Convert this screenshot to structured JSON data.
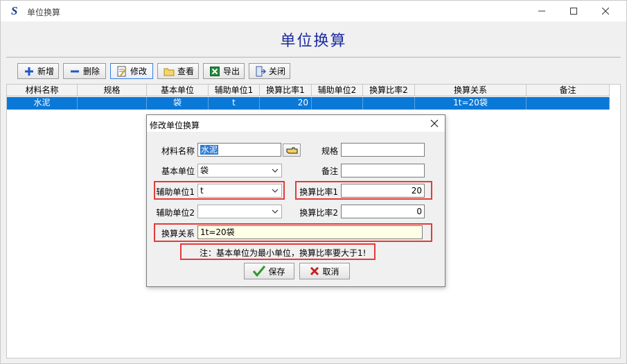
{
  "window": {
    "title": "单位换算"
  },
  "banner": {
    "title": "单位换算"
  },
  "toolbar": {
    "add": "新增",
    "delete": "删除",
    "edit": "修改",
    "view": "查看",
    "export": "导出",
    "close": "关闭"
  },
  "table": {
    "columns": [
      "材料名称",
      "规格",
      "基本单位",
      "辅助单位1",
      "换算比率1",
      "辅助单位2",
      "换算比率2",
      "换算关系",
      "备注"
    ],
    "rows": [
      {
        "name": "水泥",
        "spec": "",
        "base_unit": "袋",
        "aux_unit1": "t",
        "ratio1": "20",
        "aux_unit2": "",
        "ratio2": "",
        "relation": "1t=20袋",
        "remark": ""
      }
    ]
  },
  "dialog": {
    "title": "修改单位换算",
    "labels": {
      "material_name": "材料名称",
      "spec": "规格",
      "base_unit": "基本单位",
      "remark": "备注",
      "aux_unit1": "辅助单位1",
      "ratio1": "换算比率1",
      "aux_unit2": "辅助单位2",
      "ratio2": "换算比率2",
      "relation": "换算关系"
    },
    "values": {
      "material_name": "水泥",
      "spec": "",
      "base_unit": "袋",
      "remark": "",
      "aux_unit1": "t",
      "ratio1": "20",
      "aux_unit2": "",
      "ratio2": "0",
      "relation": "1t=20袋"
    },
    "note": "注：基本单位为最小单位，换算比率要大于1!",
    "save": "保存",
    "cancel": "取消"
  },
  "colors": {
    "banner_title": "#1c2aa0",
    "selection": "#0a78d7",
    "highlight_box": "#e33a3a",
    "relation_field_bg": "#ffffe8"
  }
}
